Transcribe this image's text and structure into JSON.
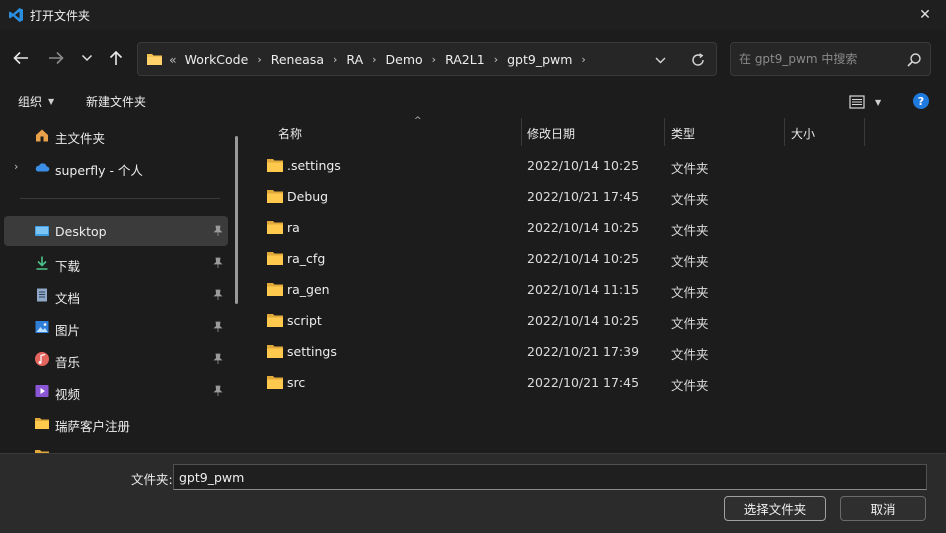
{
  "window": {
    "title": "打开文件夹",
    "app_icon": "vscode-icon",
    "close": "✕"
  },
  "nav": {
    "back_icon": "back-arrow-icon",
    "forward_icon": "forward-arrow-icon",
    "recent_icon": "chevron-down-icon",
    "up_icon": "up-arrow-icon"
  },
  "address": {
    "overflow": "«",
    "crumbs": [
      "WorkCode",
      "Reneasa",
      "RA",
      "Demo",
      "RA2L1",
      "gpt9_pwm"
    ],
    "separator": "›"
  },
  "search": {
    "placeholder": "在 gpt9_pwm 中搜索"
  },
  "toolbar": {
    "organize": "组织",
    "new_folder": "新建文件夹",
    "help": "?"
  },
  "sidebar": {
    "items": [
      {
        "label": "主文件夹",
        "icon": "home-icon"
      },
      {
        "label": "superfly - 个人",
        "icon": "onedrive-icon"
      },
      {
        "label": "Desktop",
        "icon": "desktop-icon"
      },
      {
        "label": "下载",
        "icon": "download-icon"
      },
      {
        "label": "文档",
        "icon": "document-icon"
      },
      {
        "label": "图片",
        "icon": "pictures-icon"
      },
      {
        "label": "音乐",
        "icon": "music-icon"
      },
      {
        "label": "视频",
        "icon": "video-icon"
      },
      {
        "label": "瑞萨客户注册",
        "icon": "folder-icon"
      }
    ]
  },
  "columns": {
    "name": "名称",
    "modified": "修改日期",
    "type": "类型",
    "size": "大小"
  },
  "files": [
    {
      "name": ".settings",
      "modified": "2022/10/14 10:25",
      "type": "文件夹"
    },
    {
      "name": "Debug",
      "modified": "2022/10/21 17:45",
      "type": "文件夹"
    },
    {
      "name": "ra",
      "modified": "2022/10/14 10:25",
      "type": "文件夹"
    },
    {
      "name": "ra_cfg",
      "modified": "2022/10/14 10:25",
      "type": "文件夹"
    },
    {
      "name": "ra_gen",
      "modified": "2022/10/14 11:15",
      "type": "文件夹"
    },
    {
      "name": "script",
      "modified": "2022/10/14 10:25",
      "type": "文件夹"
    },
    {
      "name": "settings",
      "modified": "2022/10/21 17:39",
      "type": "文件夹"
    },
    {
      "name": "src",
      "modified": "2022/10/21 17:45",
      "type": "文件夹"
    }
  ],
  "footer": {
    "folder_label": "文件夹:",
    "folder_value": "gpt9_pwm",
    "select_button": "选择文件夹",
    "cancel_button": "取消"
  },
  "colors": {
    "folder": "#f2c14e",
    "accent": "#1f7ae0",
    "background": "#1c1c1c"
  }
}
